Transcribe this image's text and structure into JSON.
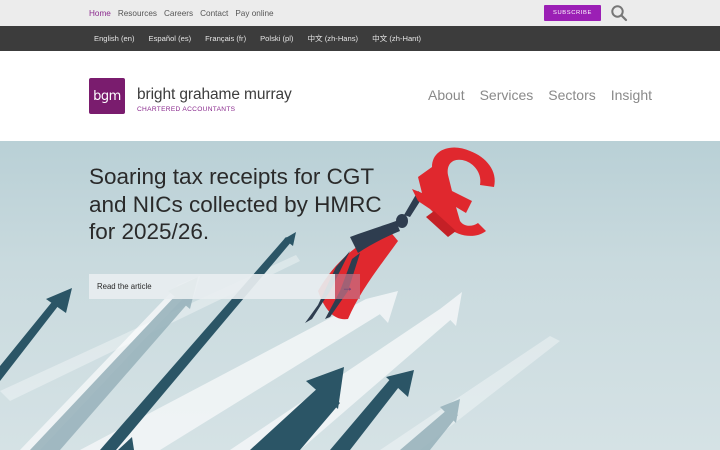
{
  "topnav": {
    "items": [
      "Home",
      "Resources",
      "Careers",
      "Contact",
      "Pay online"
    ],
    "active_index": 0
  },
  "subscribe_label": "SUBSCRIBE",
  "languages": [
    "English (en)",
    "Español (es)",
    "Français (fr)",
    "Polski (pl)",
    "中文 (zh-Hans)",
    "中文 (zh-Hant)"
  ],
  "brand": {
    "logo_text": "bgm",
    "name": "bright grahame murray",
    "tagline": "CHARTERED ACCOUNTANTS"
  },
  "mainnav": [
    "About",
    "Services",
    "Sectors",
    "Insight"
  ],
  "hero": {
    "title": "Soaring tax receipts for CGT and NICs collected by HMRC for 2025/26.",
    "cta_label": "Read the article",
    "cta_arrow": "→"
  },
  "colors": {
    "brand_purple": "#7a1c6e",
    "subscribe_purple": "#9b1fb5",
    "active_link": "#8b2b8e",
    "langbar_bg": "#3c3c3c",
    "pound_red": "#e0282e"
  },
  "icons": {
    "search": "search-icon",
    "arrow": "arrow-right-icon",
    "pound": "pound-sign-icon"
  }
}
